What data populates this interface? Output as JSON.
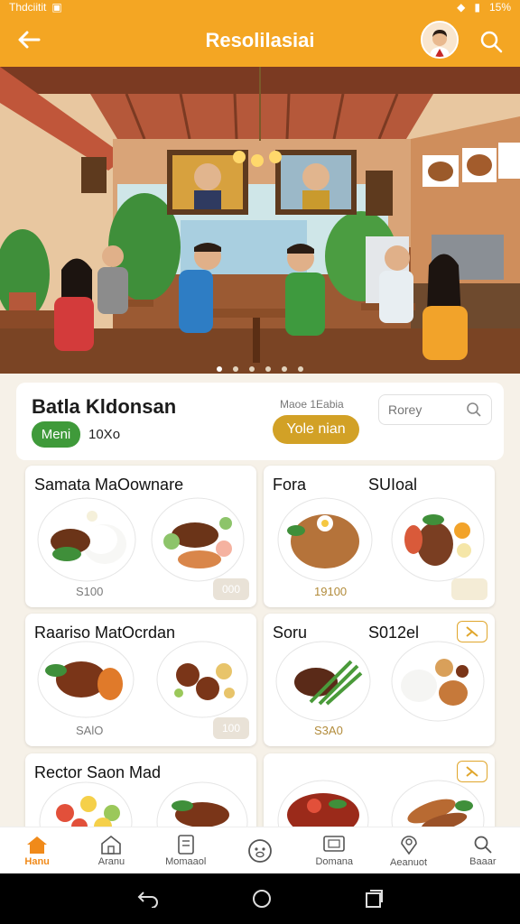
{
  "status_bar": {
    "left_text": "Thdciitit",
    "battery": "15%"
  },
  "app_bar": {
    "title": "Resolilasiai"
  },
  "info": {
    "restaurant_name": "Batla Kldonsan",
    "menu_pill": "Meni",
    "menu_count": "10Xo",
    "info_label": "Maoe 1Eabia",
    "yellow_pill": "Yole nian",
    "search_placeholder": "Rorey"
  },
  "cards": [
    {
      "name": "Samata MaOownare",
      "price": "S100",
      "tag": "000"
    },
    {
      "name": "Fora",
      "name2": "SUIoal",
      "price": "19100",
      "tag": ""
    },
    {
      "name": "Raariso MatOcrdan",
      "price": "SAlO",
      "tag": "100"
    },
    {
      "name": "Soru",
      "name2": "S012el",
      "price": "S3A0",
      "tag": ""
    },
    {
      "name": "Rector Saon Mad",
      "price": "",
      "tag": ""
    },
    {
      "name": "",
      "price": "",
      "tag": ""
    }
  ],
  "nav": [
    {
      "label": "Hanu",
      "icon": "home-icon"
    },
    {
      "label": "Aranu",
      "icon": "store-icon"
    },
    {
      "label": "Momaaol",
      "icon": "menu-book-icon"
    },
    {
      "label": "",
      "icon": "pig-icon"
    },
    {
      "label": "Domana",
      "icon": "tv-icon"
    },
    {
      "label": "Aeanuot",
      "icon": "location-icon"
    },
    {
      "label": "Baaar",
      "icon": "search-icon"
    }
  ],
  "colors": {
    "primary": "#f4a623",
    "green": "#3f9a3a",
    "gold": "#d2a126",
    "nav_active": "#f08a1a"
  }
}
